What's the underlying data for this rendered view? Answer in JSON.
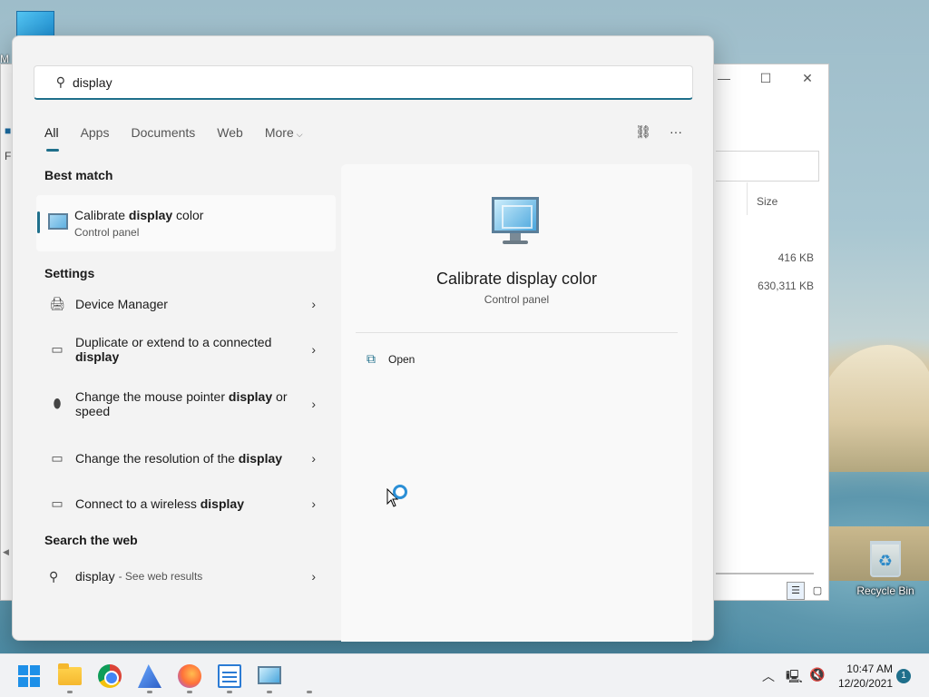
{
  "desktop": {
    "top_icon_fragment": "M",
    "recycle_bin_label": "Recycle Bin"
  },
  "explorer": {
    "left_fragment_1": "■",
    "left_fragment_2": "Fi",
    "size_header": "Size",
    "rows": [
      "416 KB",
      "630,311 KB"
    ]
  },
  "search": {
    "query": "display",
    "tabs": [
      {
        "label": "All",
        "active": true
      },
      {
        "label": "Apps"
      },
      {
        "label": "Documents"
      },
      {
        "label": "Web"
      },
      {
        "label": "More"
      }
    ]
  },
  "results": {
    "best_match_title": "Best match",
    "best_match": {
      "title_pre": "Calibrate ",
      "title_bold": "display",
      "title_post": " color",
      "subtitle": "Control panel"
    },
    "settings_title": "Settings",
    "settings": [
      {
        "pre": "Device Manager",
        "bold": "",
        "post": "",
        "icon": "device-manager-icon"
      },
      {
        "pre": "Duplicate or extend to a connected ",
        "bold": "display",
        "post": "",
        "icon": "laptop-icon"
      },
      {
        "pre": "Change the mouse pointer ",
        "bold": "display",
        "post": " or speed",
        "icon": "mouse-icon"
      },
      {
        "pre": "Change the resolution of the ",
        "bold": "display",
        "post": "",
        "icon": "laptop-icon"
      },
      {
        "pre": "Connect to a wireless ",
        "bold": "display",
        "post": "",
        "icon": "laptop-icon"
      }
    ],
    "web_title": "Search the web",
    "web": {
      "query": "display",
      "suffix": "- See web results"
    }
  },
  "details": {
    "title": "Calibrate display color",
    "subtitle": "Control panel",
    "open_label": "Open"
  },
  "taskbar": {
    "time": "10:47 AM",
    "date": "12/20/2021",
    "notification_count": "1",
    "apps": [
      "start",
      "file-explorer",
      "chrome",
      "sail-app",
      "firefox",
      "notepad",
      "display-settings"
    ]
  },
  "colors": {
    "accent": "#1f6f8b",
    "panel_bg": "#f3f3f3",
    "detail_bg": "#f9f9f9"
  }
}
